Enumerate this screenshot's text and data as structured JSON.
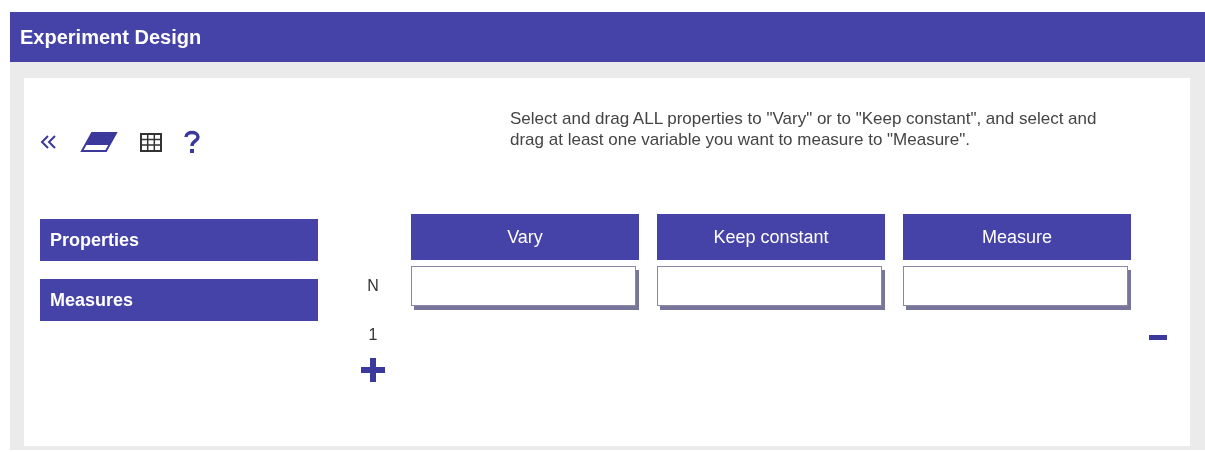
{
  "window": {
    "title": "Experiment Design"
  },
  "instructions": "Select and drag ALL properties to \"Vary\" or to \"Keep constant\", and select and drag at least one variable you want to measure to \"Measure\".",
  "panels": [
    "Properties",
    "Measures"
  ],
  "columns": [
    "Vary",
    "Keep constant",
    "Measure"
  ],
  "drop_row": {
    "label": "N"
  },
  "count_rows": [
    {
      "label": "1"
    }
  ]
}
